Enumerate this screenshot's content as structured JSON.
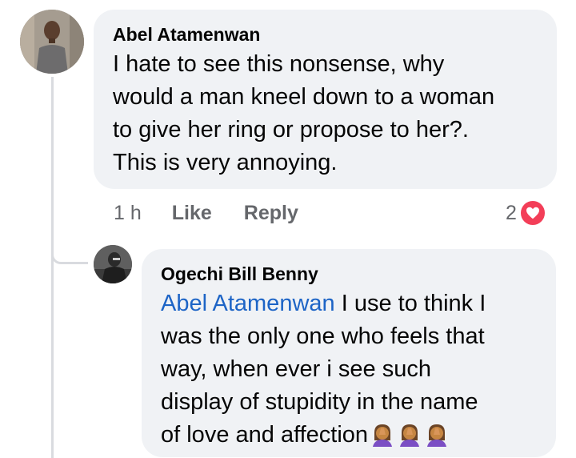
{
  "comment": {
    "author": "Abel Atamenwan",
    "text_lines": [
      "I hate to see this nonsense, why",
      "would a man kneel down to a woman",
      "to give her ring or propose to her?.",
      "This is very annoying."
    ],
    "time": "1 h",
    "like_label": "Like",
    "reply_label": "Reply",
    "reaction_count": "2",
    "reaction_icon": "heart-icon"
  },
  "reply": {
    "author": "Ogechi Bill Benny",
    "mention": "Abel Atamenwan",
    "line1_rest": " I use to think I",
    "text_lines": [
      "was the only one who feels that",
      "way, when ever i see such",
      "display of stupidity in the name"
    ],
    "last_line": "of love and affection",
    "emojis": [
      "🤦‍♀️",
      "🤦‍♀️",
      "🤦‍♀️"
    ]
  },
  "colors": {
    "bubble": "#f0f2f5",
    "mention": "#1d64c6",
    "meta": "#65676b",
    "heart": "#f33e58"
  }
}
